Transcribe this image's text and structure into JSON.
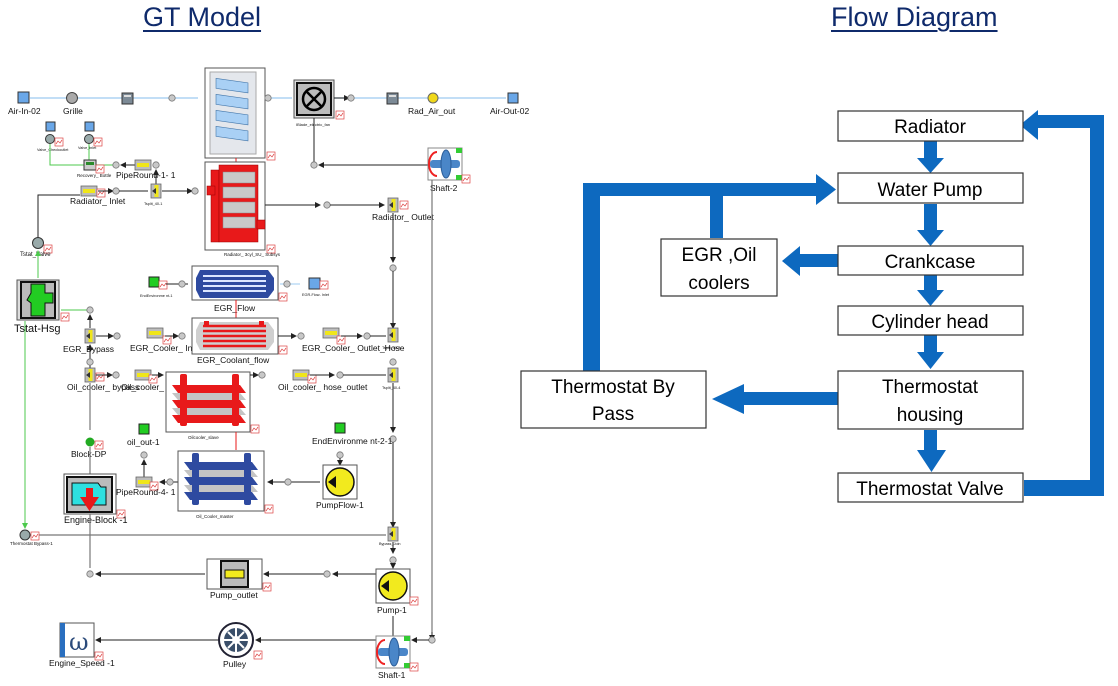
{
  "titles": {
    "left": "GT Model ",
    "right": "Flow Diagram"
  },
  "gt_model": {
    "air_path": [
      "Air-In-02",
      "Grille",
      "Rad_Air_out",
      "Air-Out-02"
    ],
    "fan_label": "IBlade_electric_fan",
    "components": {
      "valve_checkoutlet": "Valve_Checkoutlet",
      "valve_inlet": "Valve_inlet",
      "recovery_bottle": "Recovery_ Bottle",
      "pipe_round_1_1": "PipeRound-1- 1",
      "tsplit_1": "Tsplit_40-1",
      "radiator_inlet": "Radiator_ Inlet",
      "radiator": "Radiator_ 3cyl_SU_ Subsys",
      "radiator_outlet": "Radiator_ Outlet",
      "shaft_2": "Shaft-2",
      "tstat_valve": "Tstat_Valve",
      "tstat_hsg": "Tstat-Hsg",
      "end_env_1": "EndEnvironme nt-1",
      "egr_flow_inlet": "EGR-Flow- Inlet",
      "egr_flow": "EGR_Flow",
      "egr_bypass": "EGR_Bypass",
      "egr_cooler_inlet_hose": "EGR_Cooler_ Inlet_Hose",
      "egr_coolant_flow": "EGR_Coolant_flow",
      "egr_cooler_outlet_hose": "EGR_Cooler_ Outlet_Hose",
      "tsplit_3": "Tsplit_40-3",
      "oil_cooler_bypass": "Oil_cooler_ bypass",
      "oil_cooler_hose_inlet": "Oil_cooler_ hose_inlet",
      "oilcooler_slave": "Oilcooler_slave",
      "oil_cooler_hose_outlet": "Oil_cooler_ hose_outlet",
      "tsplit_4": "Tsplit_40-4",
      "oil_out_1": "oil_out-1",
      "end_env_2_1": "EndEnvironme nt-2-1",
      "block_dp": "Block-DP",
      "pipe_round_4_1": "PipeRound-4- 1",
      "oil_cooler_master": "Oil_Cooler_master",
      "pump_flow_1": "PumpFlow-1",
      "engine_block": "Engine-Block -1",
      "thermostat_bypass": "Thermostat Bypass-1",
      "bypass_join": "Bypass_Join",
      "pump_outlet": "Pump_outlet",
      "pump_1": "Pump-1",
      "engine_speed": "Engine_Speed -1",
      "pulley": "Pulley",
      "shaft_1": "Shaft-1"
    },
    "colors": {
      "coolant_red": "#e8191a",
      "egr_blue": "#2e4aa0",
      "pump_yellow": "#f2ea1e",
      "env_green": "#22cc22",
      "signal_green": "#55d455",
      "air_blue": "#9ecbf0"
    }
  },
  "flow_diagram": {
    "boxes": {
      "radiator": "Radiator",
      "water_pump": "Water Pump",
      "crankcase": "Crankcase",
      "cylinder_head": "Cylinder head",
      "thermostat_housing": [
        "Thermostat",
        "housing"
      ],
      "thermostat_valve": "Thermostat  Valve",
      "egr_oil": [
        "EGR ,Oil",
        "coolers"
      ],
      "thermostat_bypass": [
        "Thermostat  By",
        "Pass"
      ]
    },
    "arrow_color": "#0d69bf",
    "edges": [
      [
        "Radiator",
        "Water Pump"
      ],
      [
        "Water Pump",
        "Crankcase"
      ],
      [
        "Crankcase",
        "Cylinder head"
      ],
      [
        "Crankcase",
        "EGR ,Oil coolers"
      ],
      [
        "EGR ,Oil coolers",
        "Water Pump"
      ],
      [
        "Cylinder head",
        "Thermostat housing"
      ],
      [
        "Thermostat housing",
        "Thermostat By Pass"
      ],
      [
        "Thermostat By Pass",
        "Water Pump"
      ],
      [
        "Thermostat housing",
        "Thermostat Valve"
      ],
      [
        "Thermostat Valve",
        "Radiator"
      ]
    ]
  }
}
